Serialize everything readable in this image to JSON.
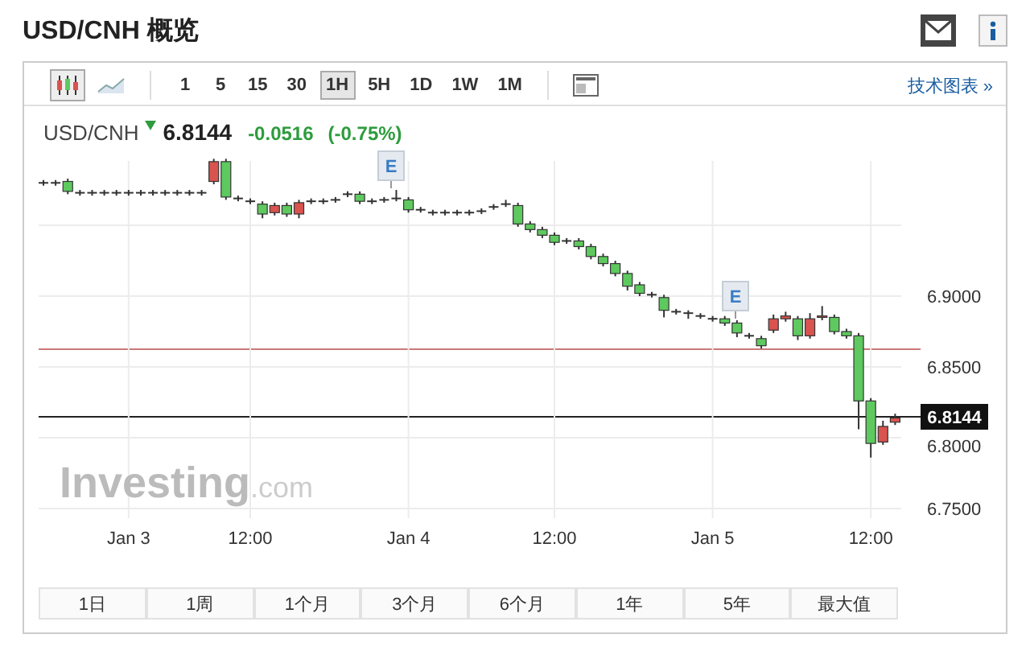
{
  "title": "USD/CNH 概览",
  "toolbar": {
    "chart_types": [
      {
        "kind": "candles",
        "selected": true
      },
      {
        "kind": "area",
        "selected": false
      }
    ],
    "intervals": [
      {
        "label": "1",
        "selected": false
      },
      {
        "label": "5",
        "selected": false
      },
      {
        "label": "15",
        "selected": false
      },
      {
        "label": "30",
        "selected": false
      },
      {
        "label": "1H",
        "selected": true
      },
      {
        "label": "5H",
        "selected": false
      },
      {
        "label": "1D",
        "selected": false
      },
      {
        "label": "1W",
        "selected": false
      },
      {
        "label": "1M",
        "selected": false
      }
    ],
    "link": "技术图表 »"
  },
  "quote": {
    "symbol": "USD/CNH",
    "rising": false,
    "price": "6.8144",
    "change": "-0.0516",
    "change_percent": "(-0.75%)"
  },
  "chart": {
    "event_markers": [
      "E",
      "E"
    ],
    "price_tag": "6.8144",
    "logo": {
      "name": "Investing",
      "suffix": ".com"
    },
    "chart_data": {
      "type": "candlestick",
      "categories": [
        null,
        null,
        null,
        null,
        null,
        null,
        null,
        "Jan 3",
        null,
        null,
        null,
        null,
        null,
        null,
        null,
        null,
        null,
        "12:00",
        null,
        null,
        null,
        null,
        null,
        null,
        null,
        null,
        null,
        null,
        null,
        null,
        "Jan 4",
        null,
        null,
        null,
        null,
        null,
        null,
        null,
        null,
        null,
        null,
        null,
        "12:00",
        null,
        null,
        null,
        null,
        null,
        null,
        null,
        null,
        null,
        null,
        null,
        null,
        "Jan 5",
        null,
        null,
        null,
        null,
        null,
        null,
        null,
        null,
        null,
        null,
        null,
        null,
        "12:00",
        null,
        null
      ],
      "ylim": [
        6.7432,
        6.9955
      ],
      "grid": true,
      "ohlc": [
        [
          6.98,
          6.982,
          6.978,
          6.98
        ],
        [
          6.98,
          6.982,
          6.978,
          6.98
        ],
        [
          6.981,
          6.983,
          6.972,
          6.974
        ],
        [
          6.973,
          6.975,
          6.971,
          6.973
        ],
        [
          6.973,
          6.975,
          6.971,
          6.973
        ],
        [
          6.973,
          6.975,
          6.971,
          6.973
        ],
        [
          6.973,
          6.975,
          6.971,
          6.973
        ],
        [
          6.973,
          6.975,
          6.971,
          6.973
        ],
        [
          6.973,
          6.975,
          6.971,
          6.973
        ],
        [
          6.973,
          6.975,
          6.971,
          6.973
        ],
        [
          6.973,
          6.975,
          6.971,
          6.973
        ],
        [
          6.973,
          6.975,
          6.971,
          6.973
        ],
        [
          6.973,
          6.975,
          6.971,
          6.973
        ],
        [
          6.973,
          6.975,
          6.971,
          6.973
        ],
        [
          6.981,
          6.997,
          6.979,
          6.995
        ],
        [
          6.995,
          6.997,
          6.968,
          6.97
        ],
        [
          6.969,
          6.971,
          6.967,
          6.969
        ],
        [
          6.967,
          6.969,
          6.965,
          6.967
        ],
        [
          6.965,
          6.967,
          6.955,
          6.958
        ],
        [
          6.959,
          6.966,
          6.957,
          6.964
        ],
        [
          6.964,
          6.966,
          6.956,
          6.958
        ],
        [
          6.958,
          6.968,
          6.955,
          6.966
        ],
        [
          6.967,
          6.969,
          6.965,
          6.967
        ],
        [
          6.967,
          6.969,
          6.965,
          6.967
        ],
        [
          6.968,
          6.97,
          6.966,
          6.968
        ],
        [
          6.972,
          6.974,
          6.97,
          6.972
        ],
        [
          6.972,
          6.974,
          6.965,
          6.967
        ],
        [
          6.967,
          6.969,
          6.965,
          6.967
        ],
        [
          6.968,
          6.97,
          6.966,
          6.968
        ],
        [
          6.969,
          6.975,
          6.967,
          6.969
        ],
        [
          6.968,
          6.97,
          6.959,
          6.961
        ],
        [
          6.961,
          6.963,
          6.959,
          6.961
        ],
        [
          6.959,
          6.961,
          6.957,
          6.959
        ],
        [
          6.959,
          6.961,
          6.957,
          6.959
        ],
        [
          6.959,
          6.961,
          6.957,
          6.959
        ],
        [
          6.959,
          6.961,
          6.957,
          6.959
        ],
        [
          6.96,
          6.962,
          6.958,
          6.96
        ],
        [
          6.963,
          6.965,
          6.961,
          6.963
        ],
        [
          6.965,
          6.968,
          6.963,
          6.965
        ],
        [
          6.964,
          6.966,
          6.949,
          6.951
        ],
        [
          6.951,
          6.953,
          6.945,
          6.947
        ],
        [
          6.947,
          6.949,
          6.941,
          6.943
        ],
        [
          6.943,
          6.945,
          6.936,
          6.938
        ],
        [
          6.939,
          6.941,
          6.937,
          6.939
        ],
        [
          6.939,
          6.941,
          6.933,
          6.935
        ],
        [
          6.935,
          6.937,
          6.926,
          6.928
        ],
        [
          6.928,
          6.93,
          6.921,
          6.923
        ],
        [
          6.923,
          6.925,
          6.914,
          6.916
        ],
        [
          6.916,
          6.918,
          6.904,
          6.907
        ],
        [
          6.908,
          6.91,
          6.9,
          6.902
        ],
        [
          6.901,
          6.903,
          6.899,
          6.901
        ],
        [
          6.899,
          6.901,
          6.885,
          6.89
        ],
        [
          6.889,
          6.891,
          6.887,
          6.889
        ],
        [
          6.888,
          6.89,
          6.884,
          6.888
        ],
        [
          6.886,
          6.888,
          6.884,
          6.886
        ],
        [
          6.884,
          6.886,
          6.882,
          6.884
        ],
        [
          6.884,
          6.886,
          6.879,
          6.881
        ],
        [
          6.881,
          6.883,
          6.871,
          6.874
        ],
        [
          6.872,
          6.874,
          6.87,
          6.872
        ],
        [
          6.87,
          6.872,
          6.863,
          6.865
        ],
        [
          6.876,
          6.887,
          6.874,
          6.884
        ],
        [
          6.884,
          6.889,
          6.882,
          6.886
        ],
        [
          6.884,
          6.886,
          6.869,
          6.872
        ],
        [
          6.872,
          6.888,
          6.87,
          6.884
        ],
        [
          6.885,
          6.893,
          6.883,
          6.886
        ],
        [
          6.885,
          6.887,
          6.873,
          6.875
        ],
        [
          6.875,
          6.877,
          6.87,
          6.872
        ],
        [
          6.872,
          6.874,
          6.806,
          6.826
        ],
        [
          6.826,
          6.828,
          6.786,
          6.796
        ],
        [
          6.797,
          6.812,
          6.795,
          6.808
        ],
        [
          6.811,
          6.817,
          6.809,
          6.814
        ]
      ],
      "yticks": [
        {
          "value": 6.9,
          "label": "6.9000"
        },
        {
          "value": 6.85,
          "label": "6.8500"
        },
        {
          "value": 6.8,
          "label": "6.8000"
        },
        {
          "value": 6.75,
          "label": "6.7500"
        }
      ]
    }
  },
  "ranges": [
    {
      "label": "1日"
    },
    {
      "label": "1周"
    },
    {
      "label": "1个月"
    },
    {
      "label": "3个月"
    },
    {
      "label": "6个月"
    },
    {
      "label": "1年"
    },
    {
      "label": "5年"
    },
    {
      "label": "最大值"
    }
  ]
}
